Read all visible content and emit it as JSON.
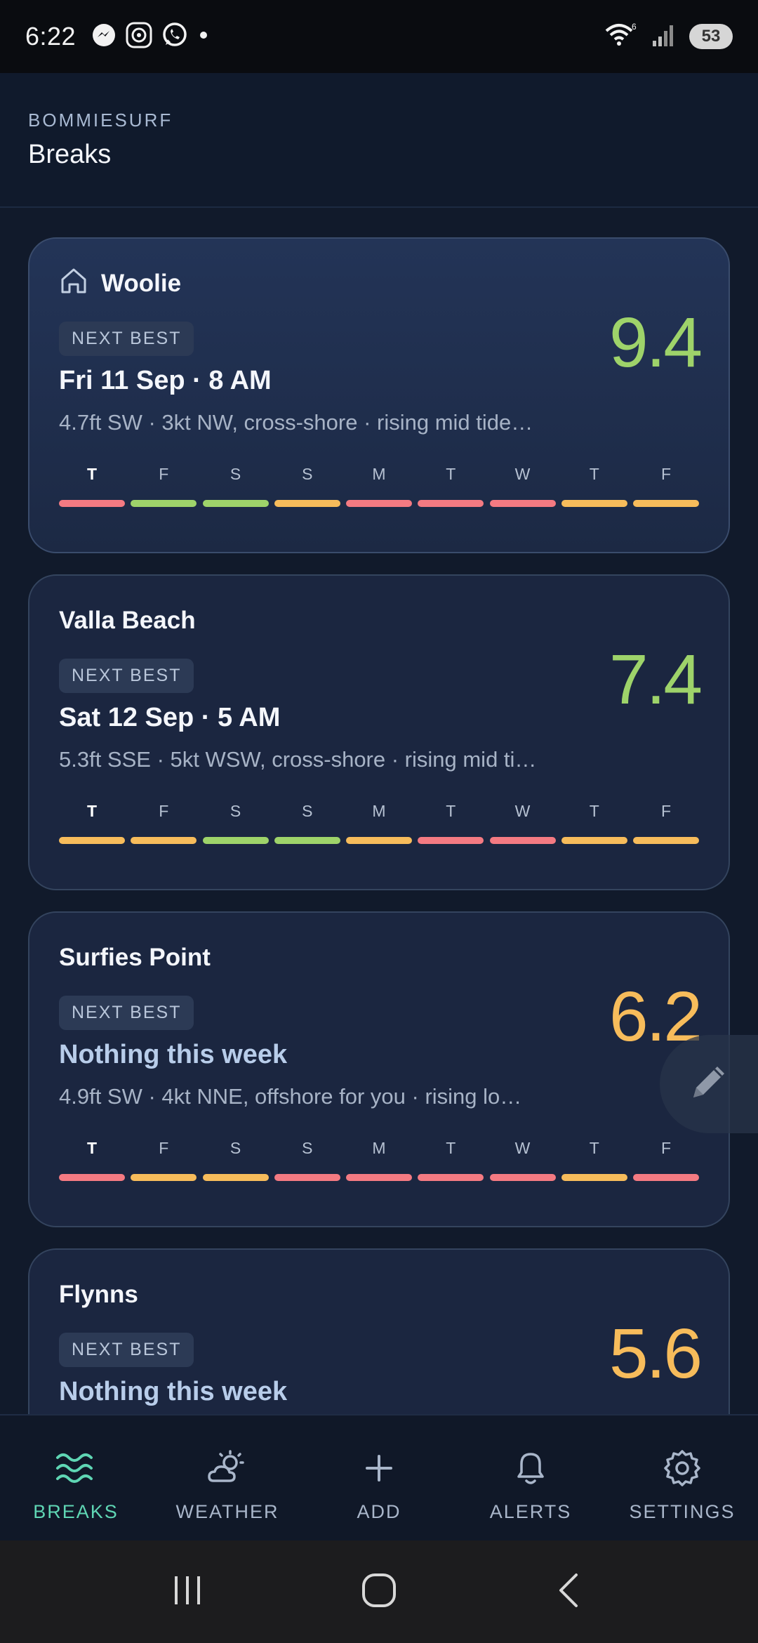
{
  "status_bar": {
    "time": "6:22",
    "battery": "53",
    "notification_icons": [
      "messenger-icon",
      "camera-app-icon",
      "whatsapp-icon",
      "dot-icon"
    ],
    "right_icons": [
      "wifi-icon",
      "signal-icon",
      "battery-icon"
    ]
  },
  "header": {
    "brand": "BOMMIESURF",
    "title": "Breaks"
  },
  "colors": {
    "good": "#9ed36a",
    "fair": "#f7bc5b",
    "poor": "#f47a82",
    "accent": "#5fd6b4"
  },
  "day_letters": [
    "T",
    "F",
    "S",
    "S",
    "M",
    "T",
    "W",
    "T",
    "F"
  ],
  "breaks": [
    {
      "name": "Woolie",
      "home": true,
      "pill": "NEXT BEST",
      "when": "Fri 11 Sep · 8 AM",
      "details": "4.7ft SW · 3kt NW, cross-shore · rising mid tide…",
      "score": "9.4",
      "score_rating": "good",
      "days": [
        "poor",
        "good",
        "good",
        "fair",
        "poor",
        "poor",
        "poor",
        "fair",
        "fair"
      ]
    },
    {
      "name": "Valla Beach",
      "home": false,
      "pill": "NEXT BEST",
      "when": "Sat 12 Sep · 5 AM",
      "details": "5.3ft SSE · 5kt WSW, cross-shore · rising mid ti…",
      "score": "7.4",
      "score_rating": "good",
      "days": [
        "fair",
        "fair",
        "good",
        "good",
        "fair",
        "poor",
        "poor",
        "fair",
        "fair"
      ]
    },
    {
      "name": "Surfies Point",
      "home": false,
      "pill": "NEXT BEST",
      "when": "Nothing this week",
      "details": "4.9ft SW · 4kt NNE, offshore for you · rising lo…",
      "score": "6.2",
      "score_rating": "fair",
      "days": [
        "poor",
        "fair",
        "fair",
        "poor",
        "poor",
        "poor",
        "poor",
        "fair",
        "poor"
      ]
    },
    {
      "name": "Flynns",
      "home": false,
      "pill": "NEXT BEST",
      "when": "Nothing this week",
      "details": "",
      "score": "5.6",
      "score_rating": "fair",
      "days": []
    }
  ],
  "nav": [
    {
      "label": "BREAKS",
      "icon": "waves-icon",
      "active": true
    },
    {
      "label": "WEATHER",
      "icon": "weather-icon",
      "active": false
    },
    {
      "label": "ADD",
      "icon": "plus-icon",
      "active": false
    },
    {
      "label": "ALERTS",
      "icon": "bell-icon",
      "active": false
    },
    {
      "label": "SETTINGS",
      "icon": "gear-icon",
      "active": false
    }
  ],
  "edit_fab": {
    "icon": "pencil-icon"
  },
  "system_nav": [
    "recents-icon",
    "home-icon",
    "back-icon"
  ]
}
